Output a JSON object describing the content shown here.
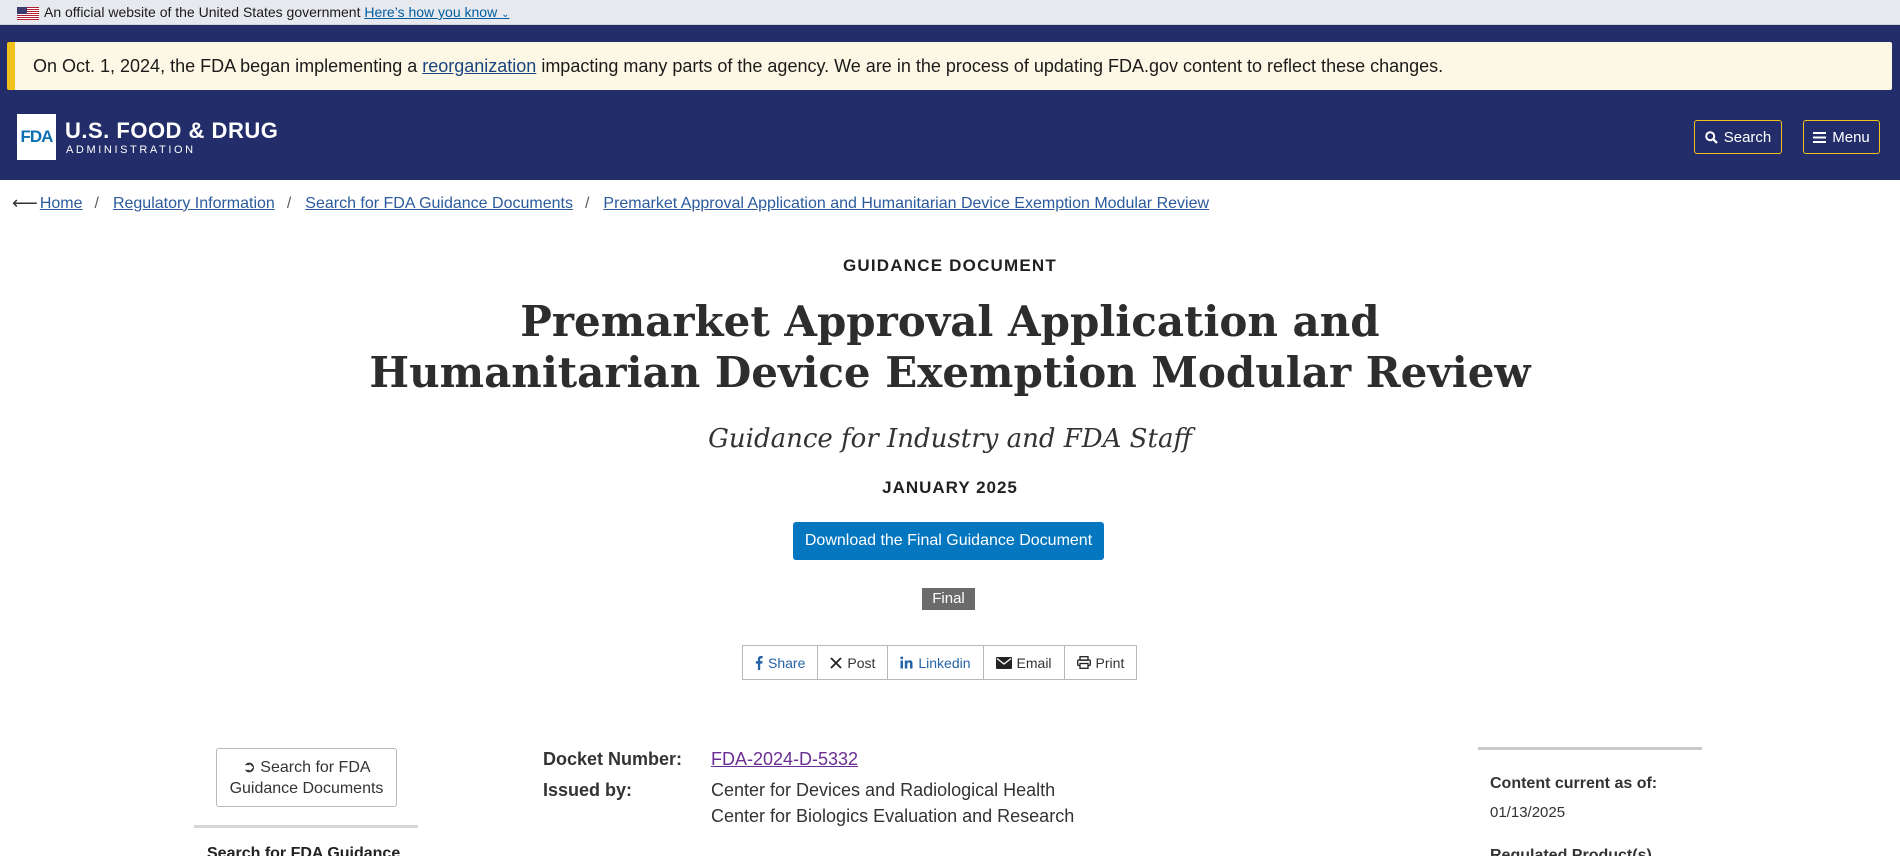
{
  "gov_banner": {
    "text": "An official website of the United States government",
    "link": "Here’s how you know"
  },
  "alert": {
    "prefix": "On Oct. 1, 2024, the FDA began implementing a ",
    "link": "reorganization",
    "suffix": " impacting many parts of the agency. We are in the process of updating FDA.gov content to reflect these changes."
  },
  "header": {
    "logo_mark": "FDA",
    "logo_line1": "U.S. FOOD & DRUG",
    "logo_line2": "ADMINISTRATION",
    "search_label": "Search",
    "menu_label": "Menu",
    "accent": "#f1c21b",
    "bg": "#222d69"
  },
  "breadcrumb": [
    "Home",
    "Regulatory Information",
    "Search for FDA Guidance Documents",
    "Premarket Approval Application and Humanitarian Device Exemption Modular Review"
  ],
  "page": {
    "kicker": "GUIDANCE DOCUMENT",
    "title_line1": "Premarket Approval Application and",
    "title_line2": "Humanitarian Device Exemption Modular Review",
    "subtitle": "Guidance for Industry and FDA Staff",
    "date": "JANUARY 2025",
    "download_label": "Download the Final Guidance Document",
    "status_badge": "Final"
  },
  "share": [
    {
      "icon": "facebook-icon",
      "label": "Share"
    },
    {
      "icon": "x-icon",
      "label": "Post"
    },
    {
      "icon": "linkedin-icon",
      "label": "Linkedin"
    },
    {
      "icon": "email-icon",
      "label": "Email"
    },
    {
      "icon": "print-icon",
      "label": "Print"
    }
  ],
  "sidebar": {
    "back_line1": "Search for FDA",
    "back_line2": "Guidance Documents",
    "section_heading": "Search for FDA Guidance"
  },
  "meta": {
    "docket_label": "Docket Number:",
    "docket_value": "FDA-2024-D-5332",
    "issued_label": "Issued by:",
    "issued_values": [
      "Center for Devices and Radiological Health",
      "Center for Biologics Evaluation and Research"
    ]
  },
  "right": {
    "content_label": "Content current as of:",
    "content_date": "01/13/2025",
    "regulated_label": "Regulated Product(s)"
  }
}
